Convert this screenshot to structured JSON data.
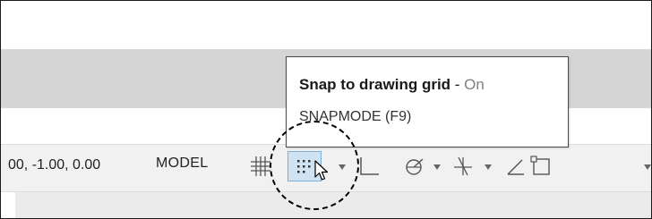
{
  "status_bar": {
    "coordinates": "00, -1.00, 0.00",
    "model_label": "MODEL",
    "icons": [
      "grid-icon",
      "snap-mode-icon",
      "ortho-icon",
      "polar-tracking-icon",
      "object-snap-tracking-icon",
      "isometric-drafting-icon",
      "object-snap-icon"
    ]
  },
  "tooltip": {
    "title": "Snap to drawing grid",
    "separator": " - ",
    "state": "On",
    "command": "SNAPMODE (F9)"
  },
  "colors": {
    "status_bar_bg": "#f1f1f1",
    "active_button_bg": "#cfe3f3",
    "band_gray": "#d5d5d5",
    "tooltip_state": "#808080"
  }
}
